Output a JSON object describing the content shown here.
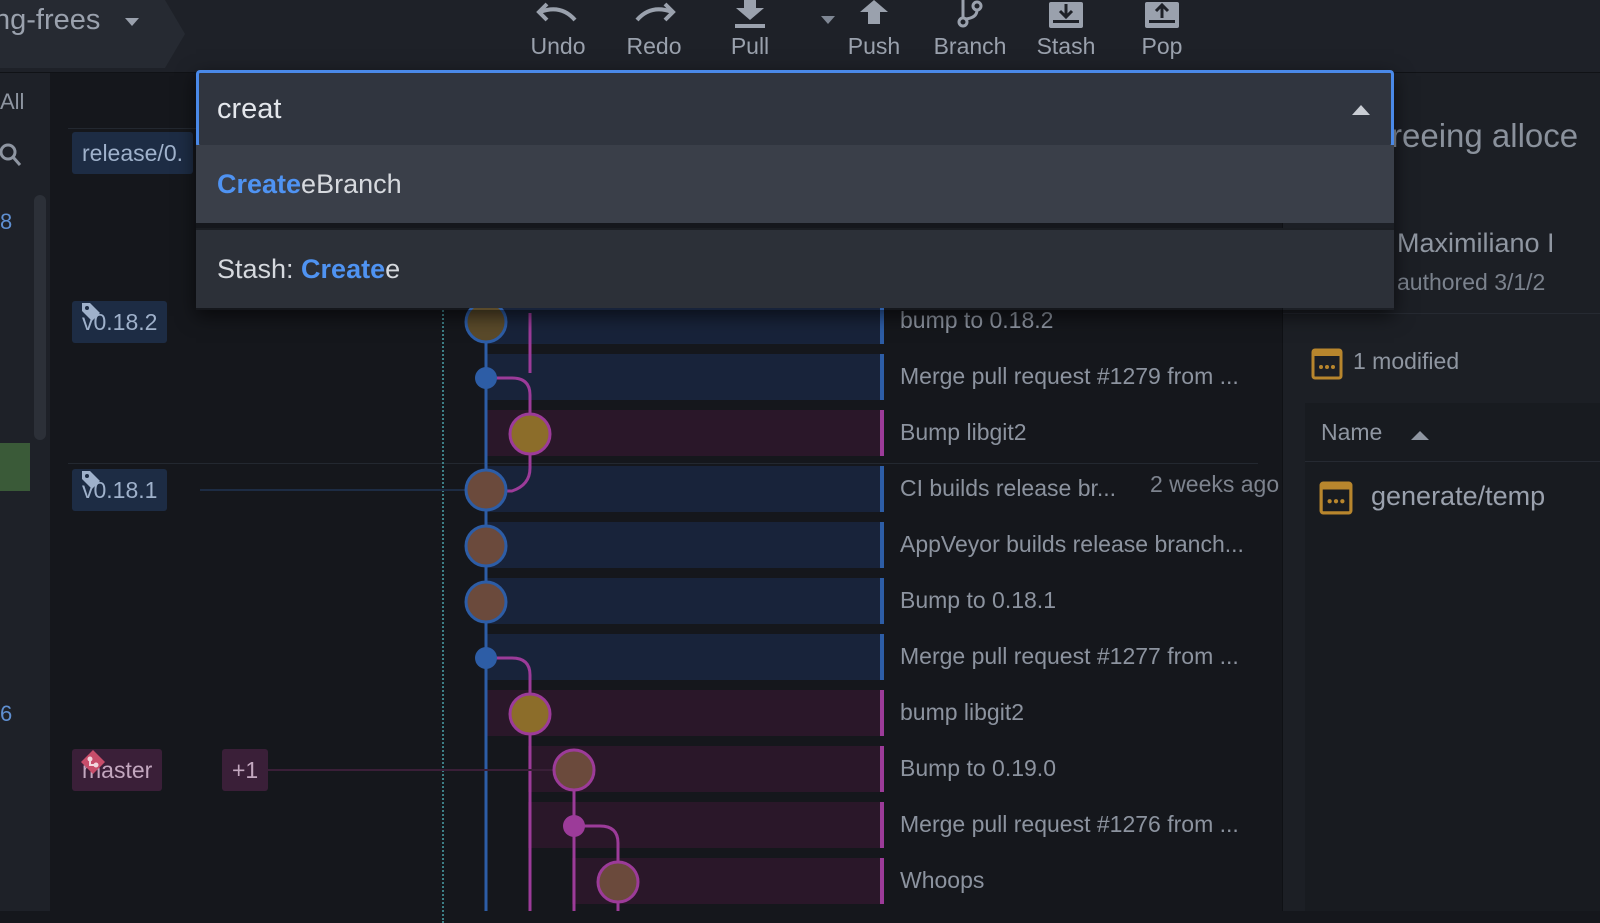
{
  "toolbar": {
    "repo_name": "ng-frees",
    "buttons": [
      {
        "label": "Undo",
        "icon": "undo-icon"
      },
      {
        "label": "Redo",
        "icon": "redo-icon"
      },
      {
        "label": "Pull",
        "icon": "pull-icon"
      },
      {
        "label": "Push",
        "icon": "push-icon"
      },
      {
        "label": "Branch",
        "icon": "branch-icon"
      },
      {
        "label": "Stash",
        "icon": "stash-icon"
      },
      {
        "label": "Pop",
        "icon": "pop-icon"
      }
    ]
  },
  "sidebar": {
    "filter_all": "All",
    "num_a": "8",
    "num_b": "6"
  },
  "palette": {
    "query": "creat",
    "items": [
      {
        "match": "Create",
        "rest": "eBranch",
        "prefix": "",
        "selected": true
      },
      {
        "prefix": "Stash: ",
        "match": "Create",
        "rest": "e",
        "selected": false
      }
    ]
  },
  "graph": {
    "refs": [
      {
        "label": "release/0.",
        "color": "#1d2c44"
      },
      {
        "label": "v0.18.2",
        "color": "#1d2c44"
      },
      {
        "label": "v0.18.1",
        "color": "#1d2c44"
      },
      {
        "label": "master",
        "color": "#3a1f38"
      },
      {
        "label": "+1",
        "color": "#3a1f38"
      }
    ],
    "commits": [
      {
        "message": "bump to 0.18.2",
        "time": ""
      },
      {
        "message": "Merge pull request #1279 from ...",
        "time": ""
      },
      {
        "message": "Bump libgit2",
        "time": ""
      },
      {
        "message": "CI builds release br...",
        "time": "2 weeks ago"
      },
      {
        "message": "AppVeyor builds release branch...",
        "time": ""
      },
      {
        "message": "Bump to 0.18.1",
        "time": ""
      },
      {
        "message": "Merge pull request #1277 from ...",
        "time": ""
      },
      {
        "message": "bump libgit2",
        "time": ""
      },
      {
        "message": "Bump to 0.19.0",
        "time": ""
      },
      {
        "message": "Merge pull request #1276 from ...",
        "time": ""
      },
      {
        "message": "Whoops",
        "time": ""
      }
    ]
  },
  "details": {
    "commit_title": "reeing alloce",
    "author": "Maximiliano I",
    "authored": "authored 3/1/2",
    "modified": "1 modified",
    "column_name": "Name",
    "file": "generate/temp"
  }
}
